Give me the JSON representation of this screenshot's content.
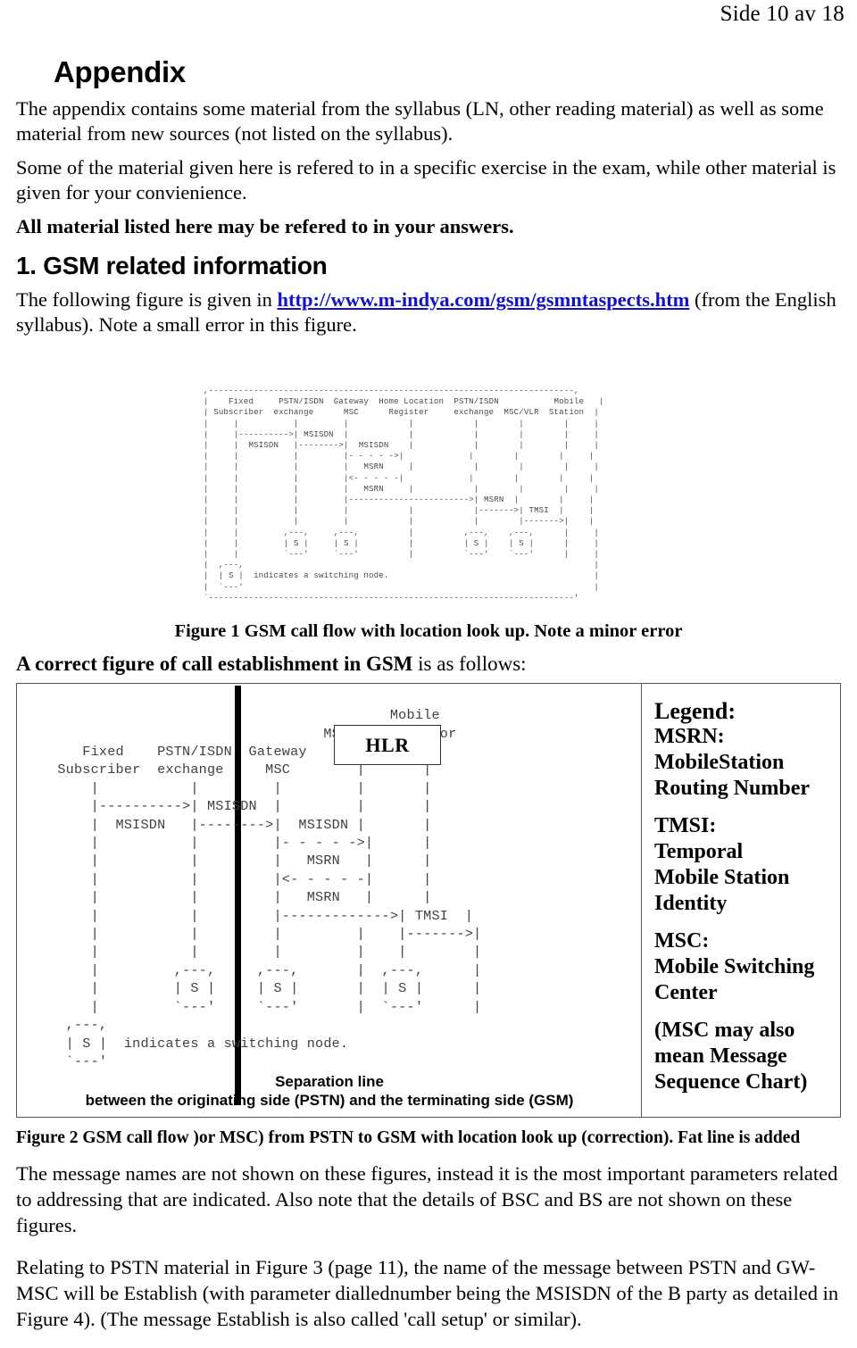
{
  "header": {
    "page_label": "Side 10 av 18"
  },
  "appendix": {
    "title": "Appendix",
    "para1": "The appendix contains some material from the syllabus (LN, other reading material) as well as some material from new sources (not listed on the syllabus).",
    "para2": "Some of the material given here is refered to in a specific exercise in the exam, while other material is given for your convienience.",
    "para3_bold": "All material listed here may be refered to in your answers."
  },
  "section1": {
    "heading": "1. GSM related information",
    "intro_before_link": "The following figure is given in ",
    "link_text": "http://www.m-indya.com/gsm/gsmntaspects.htm",
    "intro_after_link": " (from the English syllabus). Note a small error in this figure."
  },
  "figure1": {
    "ascii": ",-------------------------------------------------------------------------,\n|    Fixed     PSTN/ISDN  Gateway  Home Location  PSTN/ISDN           Mobile   |\n| Subscriber  exchange      MSC      Register     exchange  MSC/VLR  Station  |\n|     |           |         |            |            |        |        |     |\n|     |---------->| MSISDN  |            |            |        |        |     |\n|     |  MSISDN   |-------->|  MSISDN    |            |        |        |     |\n|     |           |         |- - - - ->|             |        |        |     |\n|     |           |         |   MSRN     |            |        |        |     |\n|     |           |         |<- - - - -|             |        |        |     |\n|     |           |         |   MSRN     |            |        |        |     |\n|     |           |         |------------------------>| MSRN  |        |     |\n|     |           |         |            |            |------->| TMSI  |     |\n|     |           |         |            |            |        |------->|    |\n|     |         ,---,     ,---,          |          ,---,    ,---,      |     |\n|     |         | S |     | S |          |          | S |    | S |      |     |\n|     |         `---'     `---'          |          `---'    `---'      |     |\n|  ,---,                                                                      |\n|  | S |  indicates a switching node.                                         |\n|  `---'                                                                      |\n`-------------------------------------------------------------------------'",
    "caption": "Figure 1 GSM call flow with location look up. Note a minor error"
  },
  "lead_correct": {
    "bold_part": "A correct figure of call establishment in GSM",
    "plain_part": " is as follows:"
  },
  "figure2": {
    "ascii": "                                         Mobile\n                                 MSC/VLR  Statior\n    Fixed    PSTN/ISDN  Gateway      |       |\n Subscriber  exchange     MSC        |       |\n     |           |         |         |       |\n     |---------->| MSISDN  |         |       |\n     |  MSISDN   |-------->|  MSISDN |       |\n     |           |         |- - - - ->|      |\n     |           |         |   MSRN   |      |\n     |           |         |<- - - - -|      |\n     |           |         |   MSRN   |      |\n     |           |         |------------->| TMSI  |\n     |           |         |         |    |------->|\n     |           |         |         |    |        |\n     |         ,---,     ,---,       |  ,---,      |\n     |         | S |     | S |       |  | S |      |\n     |         `---'     `---'       |  `---'      |\n  ,---,\n  | S |  indicates a switching node.\n  `---'",
    "hlr_label": "HLR",
    "separation_caption_line1": "Separation line",
    "separation_caption_line2": "between the originating side (PSTN) and the terminating side (GSM)",
    "caption": "Figure 2 GSM call flow )or MSC) from PSTN to GSM with location look up (correction). Fat line is added"
  },
  "legend": {
    "title": "Legend:",
    "entries": [
      {
        "term": "MSRN:",
        "line2": "MobileStation",
        "line3": "Routing Number"
      },
      {
        "term": "TMSI:",
        "line2": "Temporal",
        "line3": "Mobile Station",
        "line4": "Identity"
      },
      {
        "term": "MSC:",
        "line2": "Mobile Switching",
        "line3": "Center"
      },
      {
        "term": "(MSC may also",
        "line2": "mean Message",
        "line3": "Sequence Chart)"
      }
    ]
  },
  "bottom": {
    "para1": "The message names are not shown on these figures, instead it is the most important parameters related to addressing that are indicated. Also note that the details of BSC and BS are not shown on these figures.",
    "para2": "Relating to PSTN material in Figure 3 (page 11), the name of the message between PSTN and GW-MSC will be Establish (with parameter diallednumber being the MSISDN of the B party as detailed in Figure 4). (The message Establish is also called 'call setup' or similar)."
  }
}
